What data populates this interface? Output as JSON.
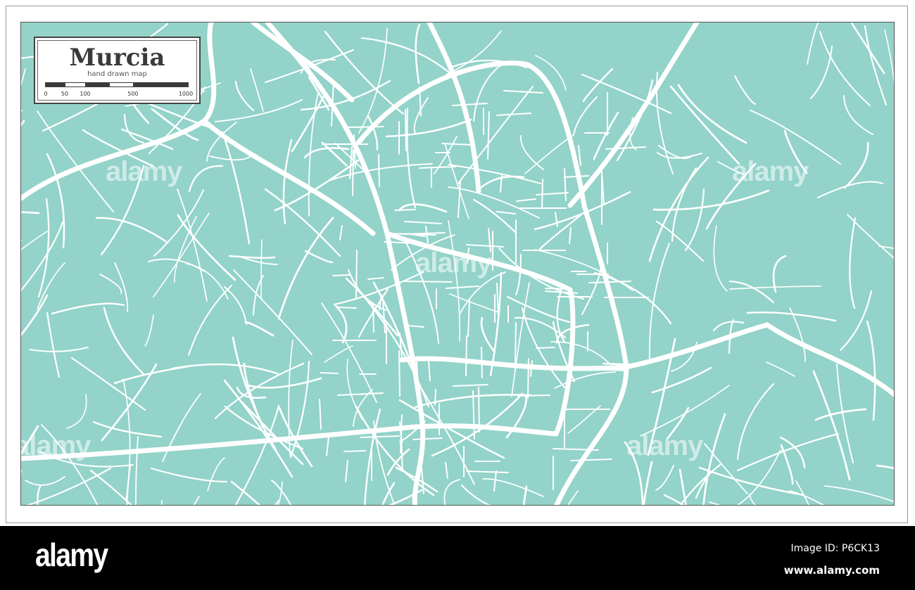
{
  "map": {
    "title": "Murcia",
    "subtitle": "hand drawn map",
    "scale_labels": [
      "0",
      "50",
      "100",
      "500",
      "1000"
    ],
    "colors": {
      "land": "#93d3c9",
      "road": "#ffffff",
      "frame": "#444444"
    },
    "watermark": "alamy"
  },
  "footer": {
    "logo": "alamy",
    "image_id": "Image ID: P6CK13",
    "website": "www.alamy.com"
  }
}
